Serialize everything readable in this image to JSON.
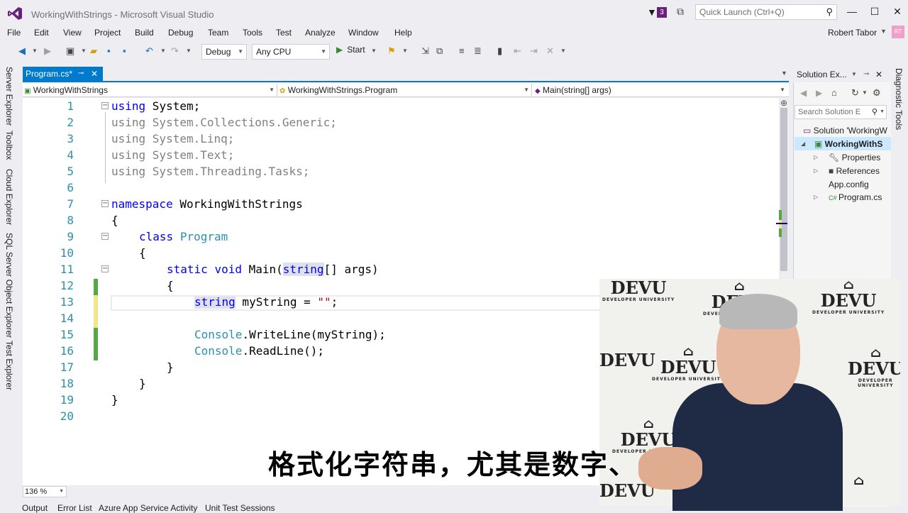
{
  "app": {
    "title": "WorkingWithStrings - Microsoft Visual Studio",
    "notification_count": "3",
    "quick_launch_placeholder": "Quick Launch (Ctrl+Q)",
    "user_name": "Robert Tabor",
    "user_initials": "RT"
  },
  "menu": [
    "File",
    "Edit",
    "View",
    "Project",
    "Build",
    "Debug",
    "Team",
    "Tools",
    "Test",
    "Analyze",
    "Window",
    "Help"
  ],
  "toolbar": {
    "config": "Debug",
    "platform": "Any CPU",
    "start_label": "Start"
  },
  "left_rail": [
    "Server Explorer",
    "Toolbox",
    "Cloud Explorer",
    "SQL Server Object Explorer",
    "Test Explorer"
  ],
  "document_tab": {
    "label": "Program.cs*"
  },
  "navbar": {
    "project": "WorkingWithStrings",
    "class": "WorkingWithStrings.Program",
    "member": "Main(string[] args)"
  },
  "code_lines": [
    "1",
    "2",
    "3",
    "4",
    "5",
    "6",
    "7",
    "8",
    "9",
    "10",
    "11",
    "12",
    "13",
    "14",
    "15",
    "16",
    "17",
    "18",
    "19",
    "20"
  ],
  "code": {
    "l1_kw": "using",
    "l1_rest": " System;",
    "l2": "using System.Collections.Generic;",
    "l3": "using System.Linq;",
    "l4": "using System.Text;",
    "l5": "using System.Threading.Tasks;",
    "l7_kw": "namespace",
    "l7_rest": " WorkingWithStrings",
    "brace_open": "{",
    "brace_close": "}",
    "l9_kw": "class",
    "l9_ty": "Program",
    "l11_kw1": "static",
    "l11_kw2": "void",
    "l11_main": " Main(",
    "l11_str": "string",
    "l11_rest": "[] args)",
    "l13_kw": "string",
    "l13_mid": " myString = ",
    "l13_str": "\"\"",
    "l13_end": ";",
    "l15_ty": "Console",
    "l15_rest": ".WriteLine(myString);",
    "l16_ty": "Console",
    "l16_rest": ".ReadLine();"
  },
  "zoom": "136 %",
  "bottom_tabs": [
    "Output",
    "Error List",
    "Azure App Service Activity",
    "Unit Test Sessions"
  ],
  "solution_explorer": {
    "title": "Solution Ex...",
    "search_placeholder": "Search Solution E",
    "solution": "Solution 'WorkingW",
    "project": "WorkingWithS",
    "items": [
      "Properties",
      "References",
      "App.config",
      "Program.cs"
    ]
  },
  "right_rail": "Diagnostic Tools",
  "webcam": {
    "logo_word": "DEVU",
    "logo_sub": "DEVELOPER UNIVERSITY"
  },
  "subtitle": "格式化字符串，尤其是数字、"
}
